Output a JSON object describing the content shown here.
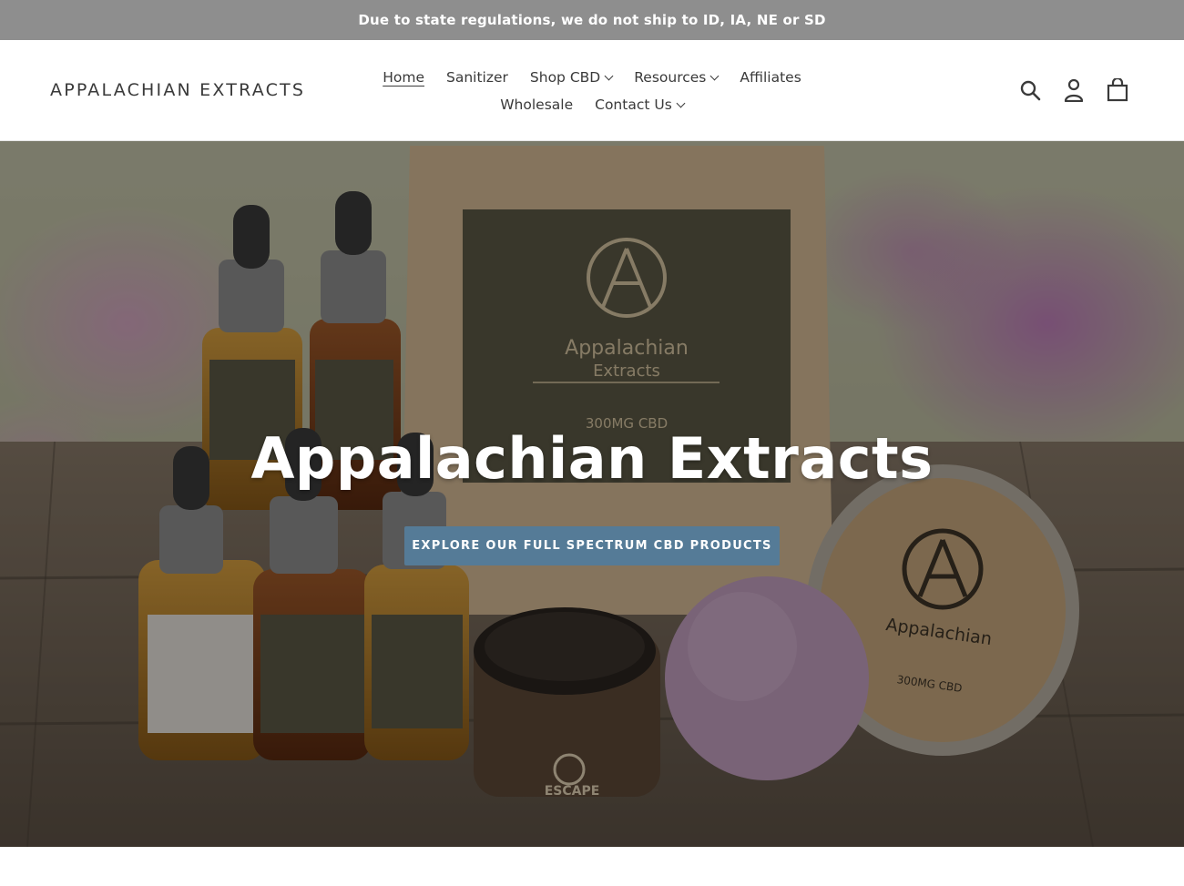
{
  "announcement": "Due to state regulations, we do not ship to ID, IA, NE or SD",
  "header": {
    "logo": "APPALACHIAN EXTRACTS",
    "nav_row1": [
      {
        "label": "Home",
        "dropdown": false,
        "active": true
      },
      {
        "label": "Sanitizer",
        "dropdown": false
      },
      {
        "label": "Shop CBD",
        "dropdown": true
      },
      {
        "label": "Resources",
        "dropdown": true
      },
      {
        "label": "Affiliates",
        "dropdown": false
      }
    ],
    "nav_row2": [
      {
        "label": "Wholesale",
        "dropdown": false
      },
      {
        "label": "Contact Us",
        "dropdown": true
      }
    ],
    "icons": [
      "search-icon",
      "account-icon",
      "cart-icon"
    ]
  },
  "hero": {
    "title": "Appalachian Extracts",
    "button": "EXPLORE OUR FULL SPECTRUM CBD PRODUCTS",
    "button_color": "#557b97",
    "product_labels": {
      "brand": "Appalachian",
      "brand_sub": "Extracts",
      "pouch_dose": "300MG CBD",
      "tin_dose": "300MG CBD",
      "jar_name": "ESCAPE"
    }
  },
  "colors": {
    "announcement_bg": "#8e8e8e",
    "text": "#3a3a3a"
  }
}
